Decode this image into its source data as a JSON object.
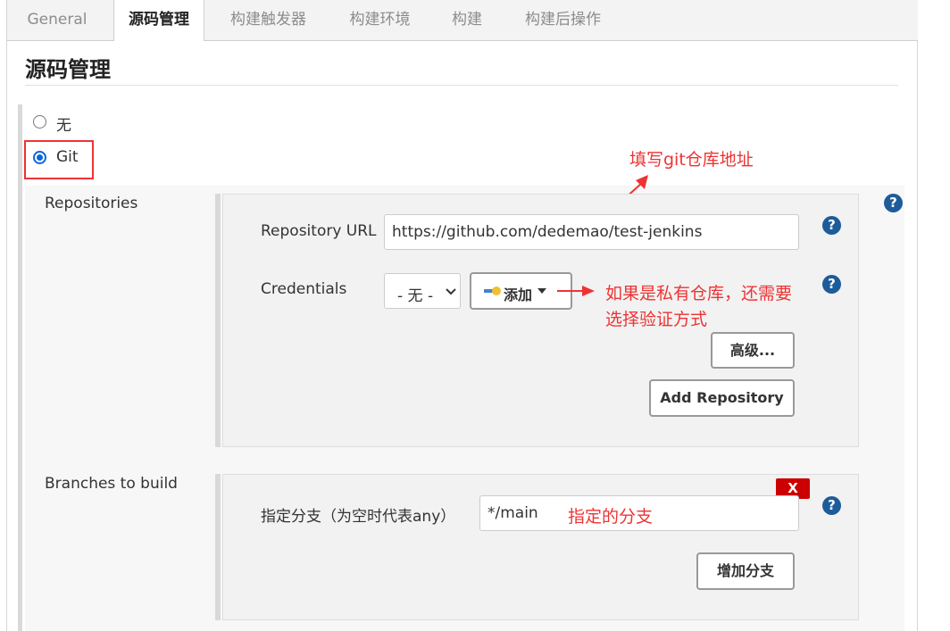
{
  "tabs": [
    "General",
    "源码管理",
    "构建触发器",
    "构建环境",
    "构建",
    "构建后操作"
  ],
  "section_title": "源码管理",
  "scm": {
    "options": [
      {
        "label": "无",
        "selected": false
      },
      {
        "label": "Git",
        "selected": true
      }
    ]
  },
  "repositories": {
    "label": "Repositories",
    "url_label": "Repository URL",
    "url_value": "https://github.com/dedemao/test-jenkins",
    "credentials_label": "Credentials",
    "credentials_value": "- 无 -",
    "add_label": "添加",
    "advanced_label": "高级...",
    "add_repo_label": "Add Repository"
  },
  "branches": {
    "label": "Branches to build",
    "branch_label": "指定分支（为空时代表any）",
    "branch_value": "*/main",
    "add_branch_label": "增加分支",
    "delete_label": "X"
  },
  "annotations": {
    "git_url": "填写git仓库地址",
    "credentials_line1": "如果是私有仓库，还需要",
    "credentials_line2": "选择验证方式",
    "branch": "指定的分支"
  },
  "help_symbol": "?",
  "colors": {
    "accent": "#1d5c99",
    "annotation": "#e33333",
    "radio": "#0a66d8",
    "delete": "#cc0000"
  }
}
